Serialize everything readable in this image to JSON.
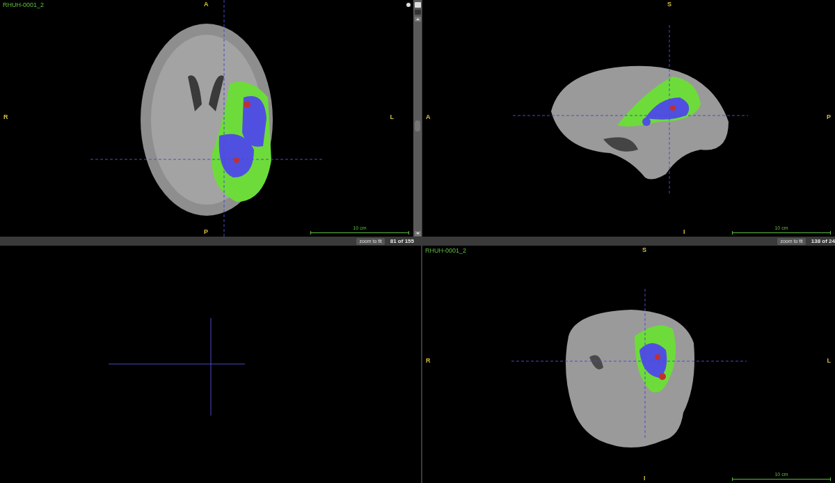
{
  "viewports": [
    {
      "kind": "picture",
      "title": "RHUH-0001_2",
      "labels": {
        "top": "A",
        "left": "R",
        "right": "L",
        "bottom": "P"
      },
      "scale": "10 cm",
      "footer": {
        "button": "zoom to fit",
        "slice": "81 of 155"
      }
    },
    {
      "kind": "picture",
      "labels": {
        "top": "S",
        "left": "A",
        "right": "P",
        "bottom": "I"
      },
      "scale": "10 cm",
      "footer": {
        "button": "zoom to fit",
        "slice": "138 of 24"
      }
    },
    {
      "kind": "empty"
    },
    {
      "kind": "picture",
      "title": "RHUH-0001_2",
      "labels": {
        "top": "S",
        "left": "R",
        "right": "L",
        "bottom": "I"
      },
      "scale": "10 cm"
    }
  ]
}
